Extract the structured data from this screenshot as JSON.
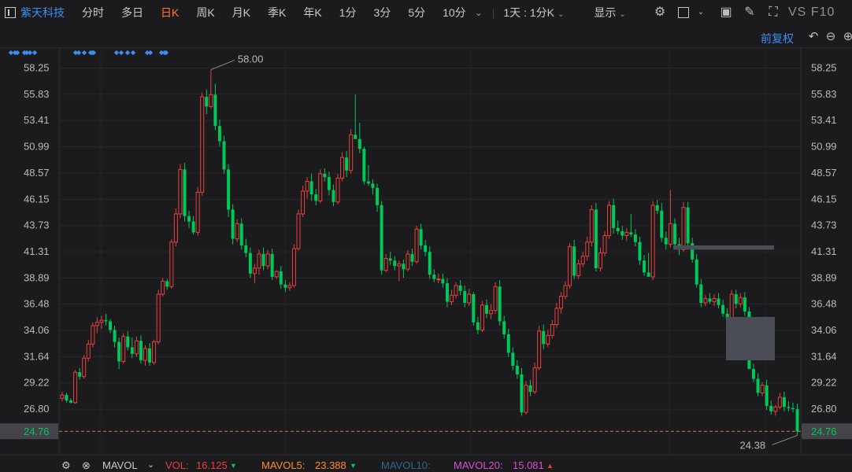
{
  "toolbar": {
    "stock_name": "紫天科技",
    "items": [
      "分时",
      "多日",
      "日K",
      "周K",
      "月K",
      "季K",
      "年K",
      "1分",
      "3分",
      "5分",
      "10分"
    ],
    "active": "日K",
    "period_select": "1天 : 1分K",
    "display_label": "显示",
    "right_text": "VS F10"
  },
  "price_mode": "前复权",
  "bottom": {
    "indicator": "MAVOL",
    "vol_label": "VOL:",
    "vol_value": "16.125",
    "mavol5_label": "MAVOL5:",
    "mavol5_value": "23.388",
    "mavol10_label": "MAVOL10:",
    "mavol20_label": "MAVOL20:",
    "mavol20_value": "15.081"
  },
  "colors": {
    "up": "#e8413b",
    "down": "#00c85a",
    "accent": "#3d8ef0",
    "active_tab": "#ff7a2f",
    "price_line": "#e07a3c",
    "mavol5": "#ff8c2a",
    "mavol10": "#2a6a8c",
    "mavol20": "#d94fd0"
  },
  "chart_data": {
    "type": "candlestick",
    "y_ticks": [
      58.25,
      55.83,
      53.41,
      50.99,
      48.57,
      46.15,
      43.73,
      41.31,
      38.89,
      36.48,
      34.06,
      31.64,
      29.22,
      26.8
    ],
    "ylim": [
      22.6,
      60.1
    ],
    "current_price": "24.76",
    "high_label": "58.00",
    "low_label": "24.38",
    "ohlc": [
      [
        27.8,
        28.4,
        27.5,
        28.1
      ],
      [
        28.1,
        28.3,
        27.4,
        27.6
      ],
      [
        27.6,
        27.8,
        27.3,
        27.4
      ],
      [
        27.4,
        30.4,
        27.3,
        30.2
      ],
      [
        30.2,
        30.6,
        29.5,
        29.8
      ],
      [
        29.8,
        31.8,
        29.6,
        31.5
      ],
      [
        31.5,
        33.2,
        31.2,
        32.8
      ],
      [
        32.8,
        34.8,
        32.5,
        34.5
      ],
      [
        34.5,
        35.3,
        33.8,
        34.8
      ],
      [
        34.8,
        35.4,
        34.2,
        35.0
      ],
      [
        35.0,
        35.6,
        34.5,
        34.9
      ],
      [
        34.9,
        35.1,
        33.8,
        34.1
      ],
      [
        34.1,
        34.5,
        32.5,
        33.0
      ],
      [
        33.0,
        33.4,
        30.5,
        31.2
      ],
      [
        31.2,
        33.8,
        31.0,
        33.5
      ],
      [
        33.5,
        34.0,
        32.2,
        32.5
      ],
      [
        32.5,
        33.4,
        31.5,
        31.9
      ],
      [
        31.9,
        33.5,
        31.6,
        33.1
      ],
      [
        33.1,
        33.6,
        31.0,
        31.3
      ],
      [
        31.3,
        32.7,
        30.8,
        32.4
      ],
      [
        32.4,
        32.9,
        30.8,
        31.1
      ],
      [
        31.1,
        33.2,
        30.9,
        33.0
      ],
      [
        33.0,
        37.8,
        32.8,
        37.4
      ],
      [
        37.4,
        38.9,
        37.2,
        38.6
      ],
      [
        38.6,
        38.8,
        37.8,
        38.1
      ],
      [
        38.1,
        42.5,
        37.9,
        42.2
      ],
      [
        42.2,
        45.3,
        41.8,
        44.8
      ],
      [
        44.8,
        49.4,
        44.4,
        48.9
      ],
      [
        48.9,
        49.5,
        44.1,
        44.6
      ],
      [
        44.6,
        45.1,
        43.5,
        44.1
      ],
      [
        44.1,
        44.6,
        42.9,
        43.1
      ],
      [
        43.1,
        47.3,
        42.8,
        46.8
      ],
      [
        46.8,
        56.0,
        46.5,
        55.6
      ],
      [
        55.6,
        56.3,
        54.0,
        54.7
      ],
      [
        54.7,
        58.1,
        54.5,
        55.8
      ],
      [
        55.8,
        56.8,
        52.5,
        52.9
      ],
      [
        52.9,
        53.5,
        51.0,
        51.5
      ],
      [
        51.5,
        52.0,
        48.5,
        48.9
      ],
      [
        48.9,
        49.4,
        44.5,
        45.2
      ],
      [
        45.2,
        45.7,
        42.0,
        42.5
      ],
      [
        42.5,
        44.3,
        42.2,
        43.9
      ],
      [
        43.9,
        44.4,
        41.5,
        41.9
      ],
      [
        41.9,
        42.5,
        40.8,
        41.2
      ],
      [
        41.2,
        41.7,
        38.9,
        39.3
      ],
      [
        39.3,
        40.2,
        38.4,
        39.8
      ],
      [
        39.8,
        41.5,
        39.2,
        41.1
      ],
      [
        41.1,
        41.7,
        39.6,
        40.0
      ],
      [
        40.0,
        41.5,
        39.7,
        41.1
      ],
      [
        41.1,
        41.6,
        38.7,
        39.0
      ],
      [
        39.0,
        39.6,
        38.8,
        39.5
      ],
      [
        39.5,
        40.0,
        37.9,
        38.3
      ],
      [
        38.3,
        38.7,
        37.6,
        38.0
      ],
      [
        38.0,
        38.5,
        37.7,
        38.2
      ],
      [
        38.2,
        42.0,
        38.0,
        41.6
      ],
      [
        41.6,
        45.2,
        41.4,
        44.8
      ],
      [
        44.8,
        47.4,
        44.5,
        46.9
      ],
      [
        46.9,
        48.2,
        46.2,
        47.8
      ],
      [
        47.8,
        48.5,
        46.0,
        46.6
      ],
      [
        46.6,
        47.1,
        45.6,
        46.0
      ],
      [
        46.0,
        48.9,
        45.8,
        48.5
      ],
      [
        48.5,
        49.0,
        47.8,
        48.2
      ],
      [
        48.2,
        48.7,
        46.5,
        47.0
      ],
      [
        47.0,
        47.5,
        45.5,
        45.9
      ],
      [
        45.9,
        48.5,
        45.7,
        48.1
      ],
      [
        48.1,
        50.5,
        47.8,
        50.0
      ],
      [
        50.0,
        50.6,
        48.2,
        48.8
      ],
      [
        48.8,
        52.6,
        48.5,
        52.1
      ],
      [
        52.1,
        55.8,
        51.8,
        51.7
      ],
      [
        51.7,
        53.2,
        50.4,
        50.8
      ],
      [
        50.8,
        51.0,
        47.5,
        47.8
      ],
      [
        47.8,
        49.3,
        47.4,
        47.6
      ],
      [
        47.6,
        48.0,
        46.6,
        47.2
      ],
      [
        47.2,
        47.6,
        45.0,
        45.6
      ],
      [
        45.6,
        46.0,
        39.2,
        39.6
      ],
      [
        39.6,
        41.1,
        39.4,
        40.7
      ],
      [
        40.7,
        41.3,
        40.1,
        40.5
      ],
      [
        40.5,
        40.9,
        39.6,
        40.0
      ],
      [
        40.0,
        40.5,
        38.6,
        40.2
      ],
      [
        40.2,
        40.6,
        38.9,
        39.7
      ],
      [
        39.7,
        41.5,
        39.5,
        41.1
      ],
      [
        41.1,
        41.6,
        40.0,
        40.4
      ],
      [
        40.4,
        43.7,
        40.2,
        43.4
      ],
      [
        43.4,
        43.9,
        41.5,
        41.9
      ],
      [
        41.9,
        42.4,
        40.9,
        41.3
      ],
      [
        41.3,
        41.8,
        38.8,
        39.2
      ],
      [
        39.2,
        39.7,
        38.5,
        38.8
      ],
      [
        38.8,
        39.3,
        38.4,
        38.8
      ],
      [
        38.8,
        39.3,
        38.0,
        38.4
      ],
      [
        38.4,
        38.9,
        36.2,
        36.7
      ],
      [
        36.7,
        37.8,
        36.4,
        37.3
      ],
      [
        37.3,
        38.5,
        37.0,
        38.2
      ],
      [
        38.2,
        38.7,
        37.3,
        37.7
      ],
      [
        37.7,
        38.2,
        36.2,
        36.6
      ],
      [
        36.6,
        37.9,
        36.3,
        37.4
      ],
      [
        37.4,
        37.6,
        34.5,
        34.8
      ],
      [
        34.8,
        35.3,
        33.7,
        34.1
      ],
      [
        34.1,
        36.8,
        33.9,
        36.4
      ],
      [
        36.4,
        36.9,
        35.2,
        35.6
      ],
      [
        35.6,
        36.5,
        35.1,
        35.9
      ],
      [
        35.9,
        38.5,
        35.6,
        38.1
      ],
      [
        38.1,
        38.7,
        34.5,
        34.9
      ],
      [
        34.9,
        35.4,
        33.3,
        33.7
      ],
      [
        33.7,
        34.2,
        31.6,
        32.0
      ],
      [
        32.0,
        32.5,
        30.4,
        30.8
      ],
      [
        30.8,
        31.3,
        29.6,
        30.0
      ],
      [
        30.0,
        30.6,
        26.2,
        26.5
      ],
      [
        26.5,
        29.4,
        26.3,
        29.0
      ],
      [
        29.0,
        29.5,
        28.0,
        28.4
      ],
      [
        28.4,
        31.1,
        28.2,
        30.6
      ],
      [
        30.6,
        34.5,
        30.4,
        34.0
      ],
      [
        34.0,
        34.6,
        32.3,
        32.8
      ],
      [
        32.8,
        34.1,
        32.5,
        33.6
      ],
      [
        33.6,
        35.0,
        33.3,
        34.6
      ],
      [
        34.6,
        36.6,
        34.3,
        36.1
      ],
      [
        36.1,
        37.6,
        35.6,
        37.2
      ],
      [
        37.2,
        38.6,
        36.9,
        38.2
      ],
      [
        38.2,
        42.1,
        37.9,
        41.8
      ],
      [
        41.8,
        42.4,
        38.8,
        39.1
      ],
      [
        39.1,
        40.6,
        38.8,
        40.2
      ],
      [
        40.2,
        41.3,
        39.9,
        40.9
      ],
      [
        40.9,
        42.7,
        40.5,
        42.2
      ],
      [
        42.2,
        45.6,
        41.8,
        45.2
      ],
      [
        45.2,
        45.8,
        39.5,
        39.8
      ],
      [
        39.8,
        41.7,
        39.5,
        41.2
      ],
      [
        41.2,
        43.2,
        40.9,
        42.8
      ],
      [
        42.8,
        46.0,
        42.5,
        45.6
      ],
      [
        45.6,
        46.2,
        43.0,
        43.5
      ],
      [
        43.5,
        44.2,
        42.9,
        43.2
      ],
      [
        43.2,
        43.7,
        42.4,
        42.8
      ],
      [
        42.8,
        43.5,
        42.3,
        43.1
      ],
      [
        43.1,
        44.8,
        42.7,
        42.9
      ],
      [
        42.9,
        43.4,
        41.8,
        42.2
      ],
      [
        42.2,
        42.7,
        40.1,
        40.5
      ],
      [
        40.5,
        41.0,
        39.1,
        39.4
      ],
      [
        39.4,
        41.2,
        39.1,
        39.0
      ],
      [
        39.0,
        46.0,
        38.7,
        45.6
      ],
      [
        45.6,
        46.1,
        44.8,
        45.1
      ],
      [
        45.1,
        45.8,
        42.2,
        42.6
      ],
      [
        42.6,
        43.2,
        41.5,
        42.0
      ],
      [
        42.0,
        47.0,
        41.7,
        43.9
      ],
      [
        43.9,
        44.4,
        41.6,
        42.0
      ],
      [
        42.0,
        42.6,
        41.0,
        41.5
      ],
      [
        41.5,
        45.9,
        41.3,
        45.4
      ],
      [
        45.4,
        45.9,
        41.7,
        42.1
      ],
      [
        42.1,
        42.6,
        40.3,
        40.6
      ],
      [
        40.6,
        41.1,
        38.0,
        38.3
      ],
      [
        38.3,
        38.8,
        36.2,
        36.6
      ],
      [
        36.6,
        37.3,
        36.3,
        37.0
      ],
      [
        37.0,
        37.5,
        36.5,
        36.7
      ],
      [
        36.7,
        37.4,
        36.3,
        37.0
      ],
      [
        37.0,
        37.5,
        36.1,
        36.4
      ],
      [
        36.4,
        36.9,
        35.3,
        35.6
      ],
      [
        35.6,
        36.1,
        34.8,
        35.1
      ],
      [
        35.1,
        37.8,
        34.9,
        37.4
      ],
      [
        37.4,
        37.8,
        36.1,
        36.5
      ],
      [
        36.5,
        37.5,
        36.2,
        37.1
      ],
      [
        37.1,
        37.6,
        35.4,
        35.8
      ],
      [
        35.8,
        36.2,
        31.8,
        30.5
      ],
      [
        30.5,
        31.0,
        29.3,
        29.6
      ],
      [
        29.6,
        30.1,
        28.0,
        28.3
      ],
      [
        28.3,
        29.3,
        28.0,
        29.0
      ],
      [
        29.0,
        29.5,
        26.7,
        27.1
      ],
      [
        27.1,
        27.6,
        26.3,
        26.6
      ],
      [
        26.6,
        27.2,
        26.2,
        27.0
      ],
      [
        27.0,
        28.3,
        26.8,
        27.9
      ],
      [
        27.9,
        28.4,
        26.6,
        27.0
      ],
      [
        27.0,
        27.5,
        26.6,
        26.9
      ],
      [
        26.9,
        27.4,
        26.5,
        26.8
      ],
      [
        26.8,
        27.3,
        24.38,
        24.76
      ]
    ],
    "markers": [
      14,
      19,
      22,
      31,
      34,
      38,
      44,
      96,
      100,
      107,
      115,
      117,
      119,
      148,
      154,
      162,
      169,
      187,
      191,
      205,
      209,
      211
    ]
  }
}
